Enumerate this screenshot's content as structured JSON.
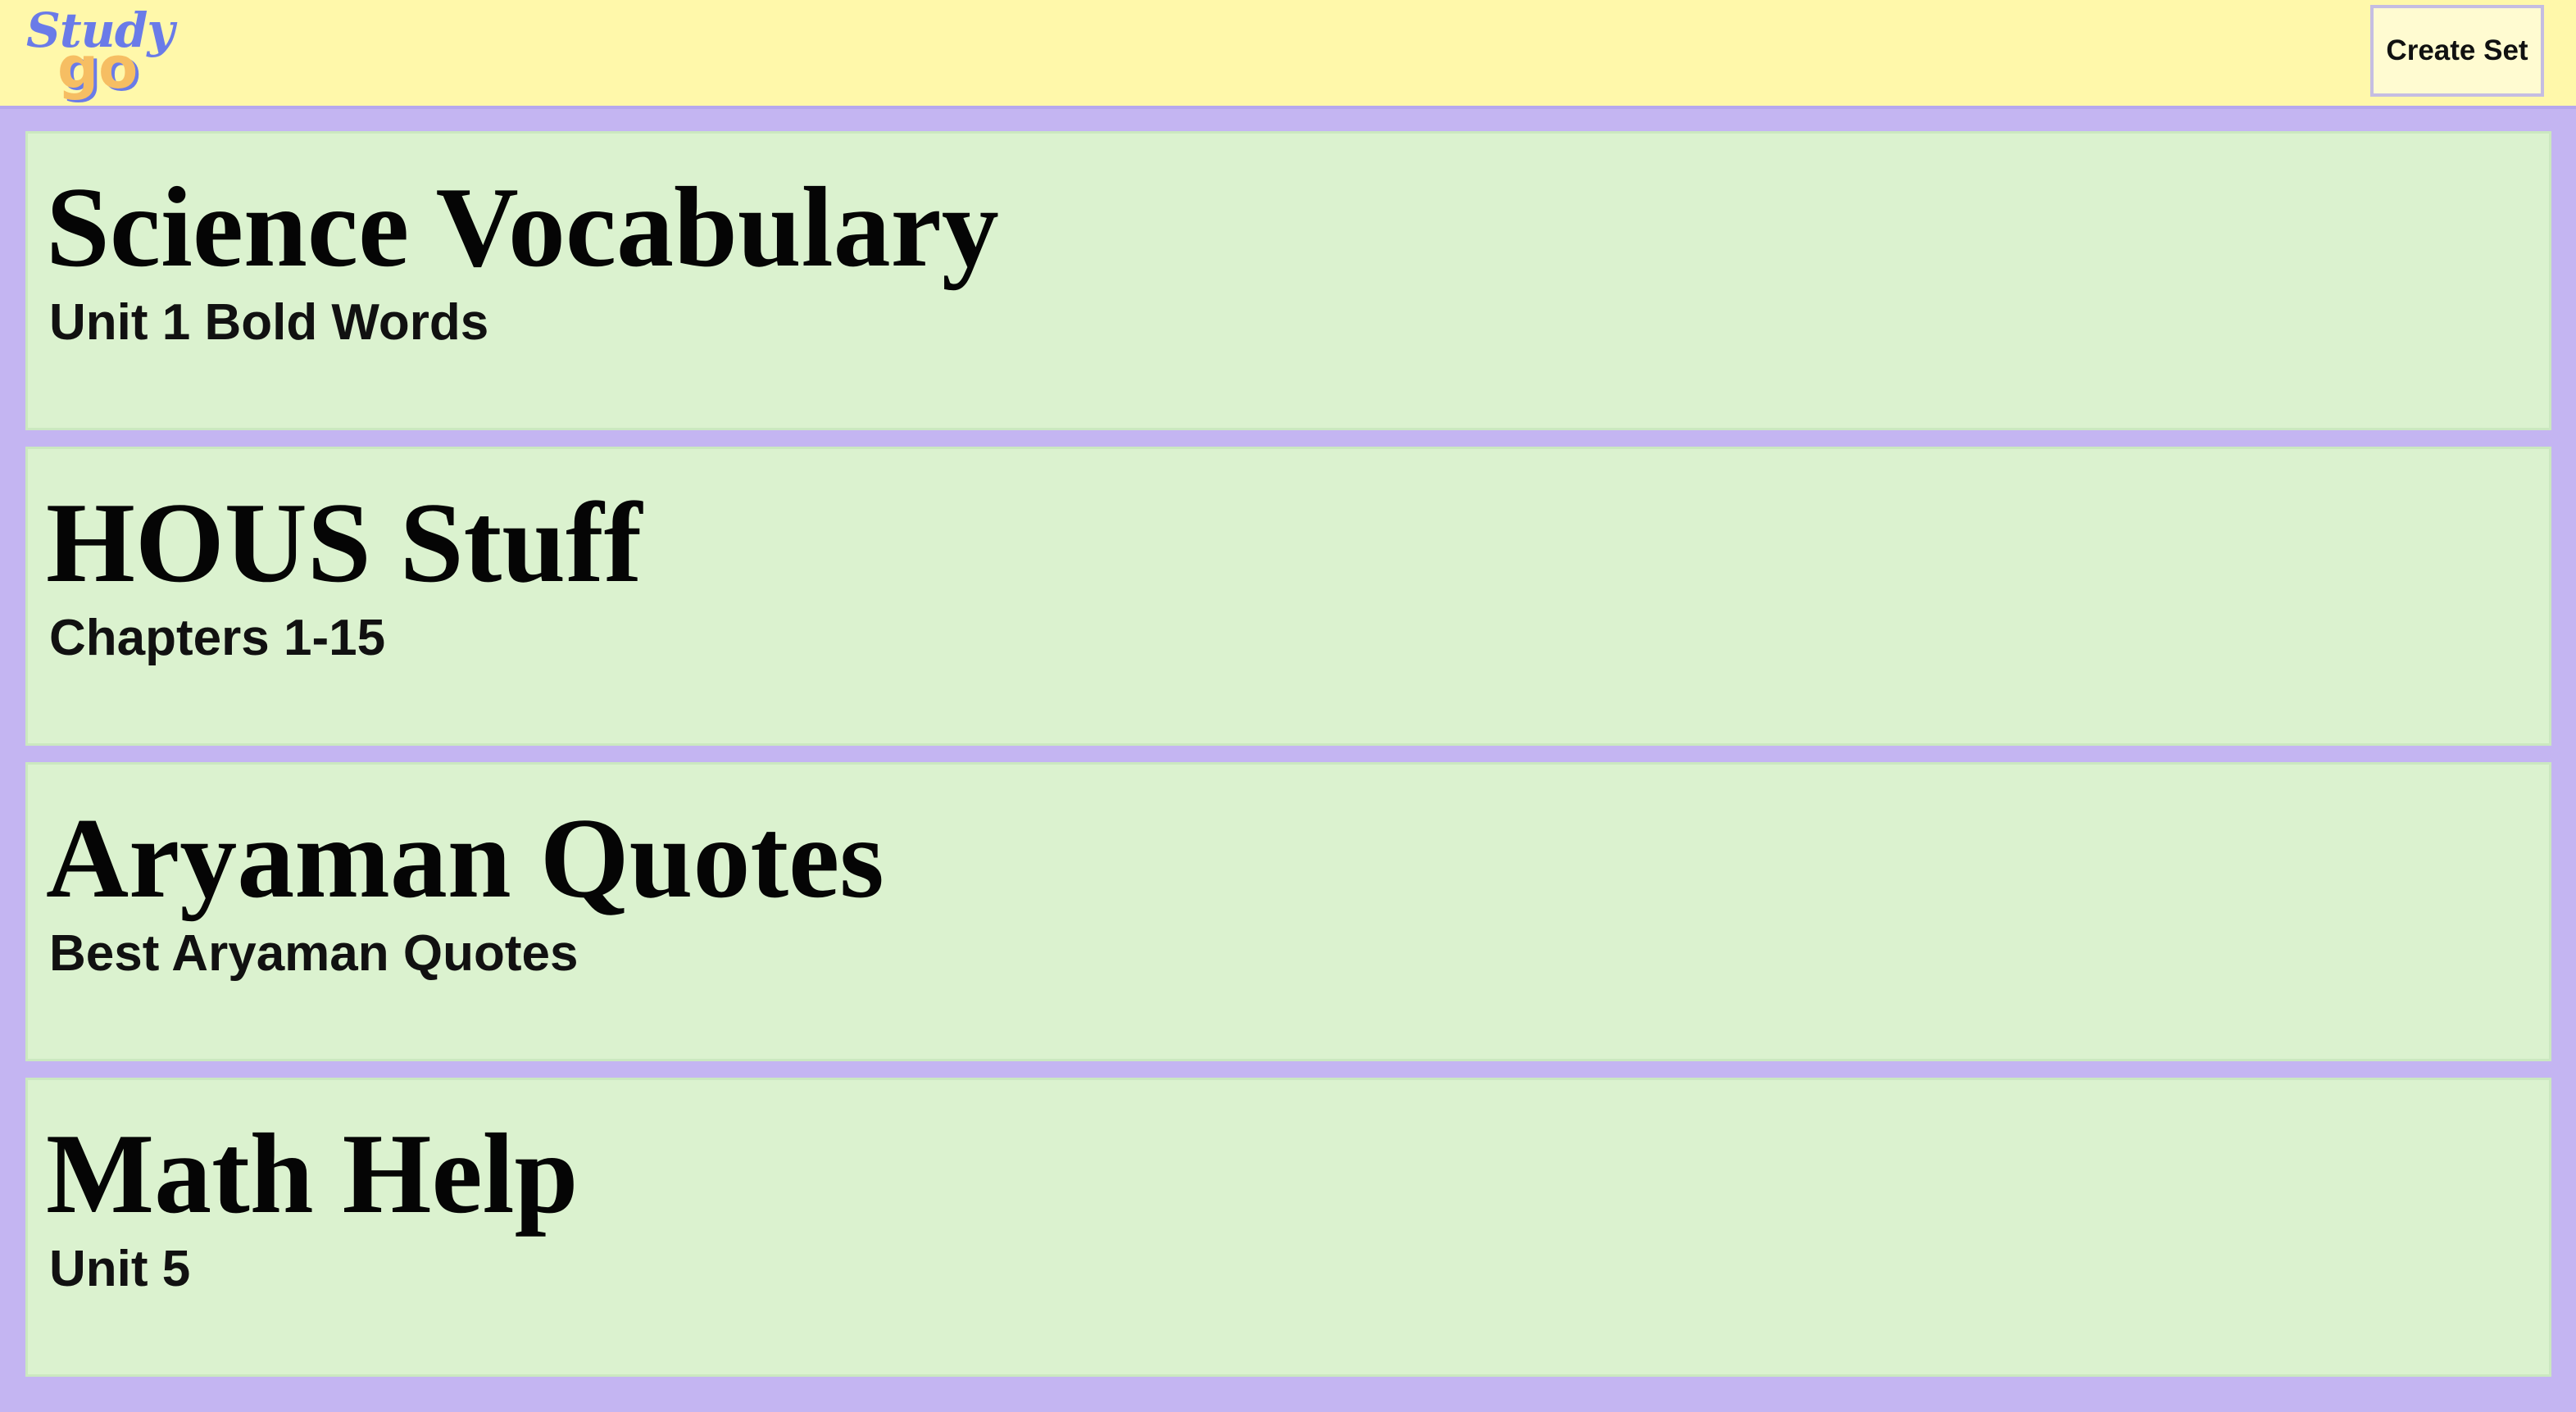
{
  "header": {
    "logo_top": "Study",
    "logo_bottom": "go",
    "create_label": "Create Set"
  },
  "sets": [
    {
      "title": "Science Vocabulary",
      "description": "Unit 1 Bold Words"
    },
    {
      "title": "HOUS Stuff",
      "description": "Chapters 1-15"
    },
    {
      "title": "Aryaman Quotes",
      "description": "Best Aryaman Quotes"
    },
    {
      "title": "Math Help",
      "description": "Unit 5"
    }
  ],
  "colors": {
    "header_bg": "#fff8aa",
    "page_bg": "#c4b5f2",
    "card_bg": "#dbf2cf",
    "logo_blue": "#6a7be8",
    "logo_orange": "#f6be63"
  }
}
